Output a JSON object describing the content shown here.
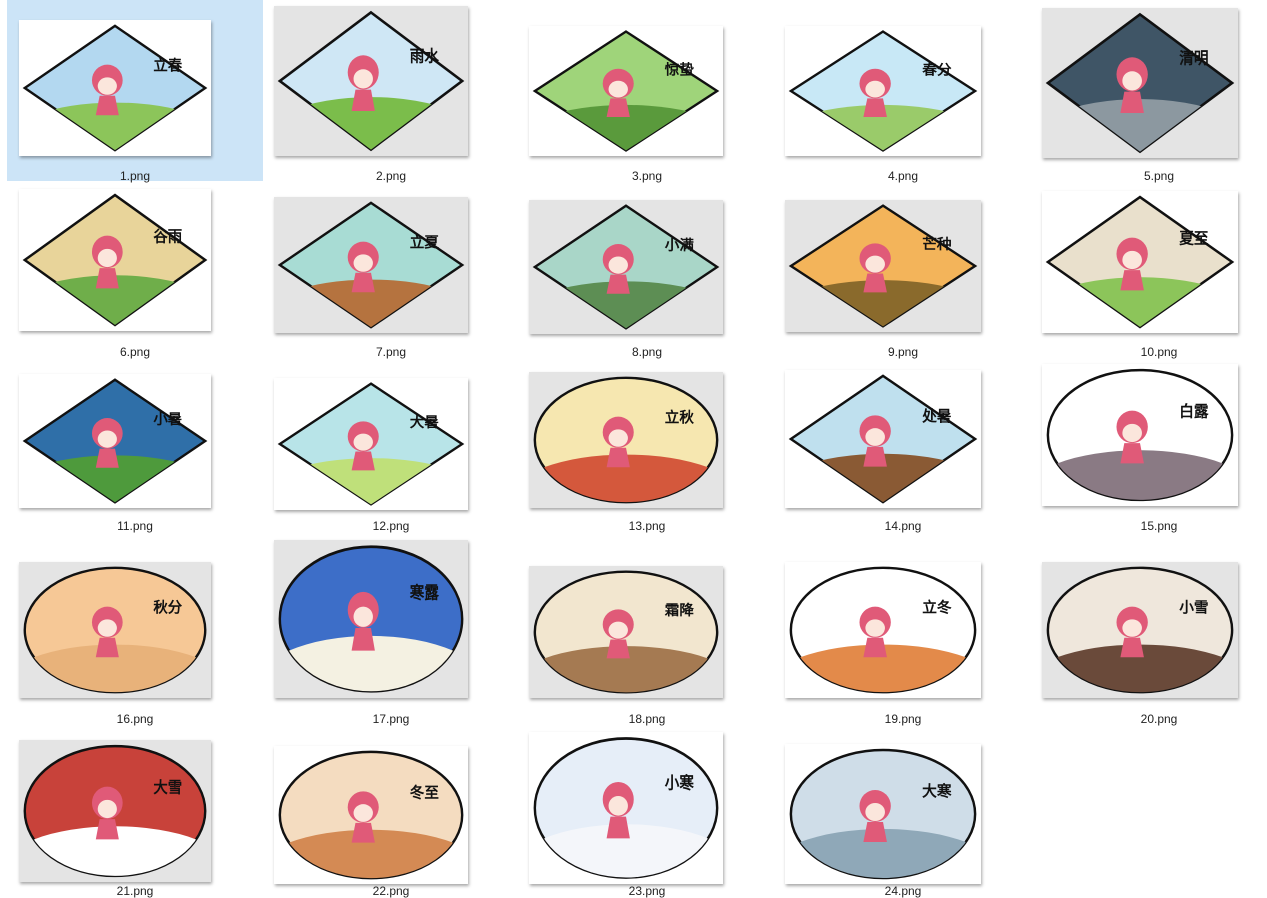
{
  "selected_index": 0,
  "files": [
    {
      "name": "1.png",
      "shape": "diamond",
      "bg": "#ffffff",
      "pal": [
        "#b3d8f0",
        "#8cc55a",
        "#e05a78"
      ],
      "text": "立春"
    },
    {
      "name": "2.png",
      "shape": "diamond",
      "bg": "#e4e4e4",
      "pal": [
        "#cfe7f5",
        "#7bbd4b",
        "#e05a78"
      ],
      "text": "雨水"
    },
    {
      "name": "3.png",
      "shape": "diamond",
      "bg": "#ffffff",
      "pal": [
        "#9fd47a",
        "#5a9a3c",
        "#e05a78"
      ],
      "text": "惊蛰"
    },
    {
      "name": "4.png",
      "shape": "diamond",
      "bg": "#ffffff",
      "pal": [
        "#c8e8f6",
        "#9acb6a",
        "#e05a78"
      ],
      "text": "春分"
    },
    {
      "name": "5.png",
      "shape": "diamond",
      "bg": "#e4e4e4",
      "pal": [
        "#3f5566",
        "#8c98a0",
        "#e05a78"
      ],
      "text": "清明"
    },
    {
      "name": "6.png",
      "shape": "diamond",
      "bg": "#ffffff",
      "pal": [
        "#e8d49a",
        "#6fae4a",
        "#e05a78"
      ],
      "text": "谷雨"
    },
    {
      "name": "7.png",
      "shape": "diamond",
      "bg": "#e4e4e4",
      "pal": [
        "#a8dcd4",
        "#b5733f",
        "#e05a78"
      ],
      "text": "立夏"
    },
    {
      "name": "8.png",
      "shape": "diamond",
      "bg": "#e4e4e4",
      "pal": [
        "#a9d6c8",
        "#5d8e54",
        "#e05a78"
      ],
      "text": "小满"
    },
    {
      "name": "9.png",
      "shape": "diamond",
      "bg": "#e4e4e4",
      "pal": [
        "#f3b45a",
        "#8a6a2c",
        "#e05a78"
      ],
      "text": "芒种"
    },
    {
      "name": "10.png",
      "shape": "diamond",
      "bg": "#ffffff",
      "pal": [
        "#e9e0cc",
        "#8cc55a",
        "#e05a78"
      ],
      "text": "夏至"
    },
    {
      "name": "11.png",
      "shape": "diamond",
      "bg": "#ffffff",
      "pal": [
        "#2f6fa8",
        "#4e9a3c",
        "#e05a78"
      ],
      "text": "小暑"
    },
    {
      "name": "12.png",
      "shape": "diamond",
      "bg": "#ffffff",
      "pal": [
        "#b8e4e8",
        "#bfe07a",
        "#e05a78"
      ],
      "text": "大暑"
    },
    {
      "name": "13.png",
      "shape": "oval",
      "bg": "#e4e4e4",
      "pal": [
        "#f6e7b0",
        "#d4583c",
        "#e05a78"
      ],
      "text": "立秋"
    },
    {
      "name": "14.png",
      "shape": "diamond",
      "bg": "#ffffff",
      "pal": [
        "#bfe0ee",
        "#8a5a34",
        "#e05a78"
      ],
      "text": "处暑"
    },
    {
      "name": "15.png",
      "shape": "oval",
      "bg": "#ffffff",
      "pal": [
        "#ffffff",
        "#8a7a84",
        "#e05a78"
      ],
      "text": "白露"
    },
    {
      "name": "16.png",
      "shape": "oval",
      "bg": "#e4e4e4",
      "pal": [
        "#f6c896",
        "#e8b27a",
        "#e05a78"
      ],
      "text": "秋分"
    },
    {
      "name": "17.png",
      "shape": "oval",
      "bg": "#e4e4e4",
      "pal": [
        "#3d6ec8",
        "#f4f1e2",
        "#e05a78"
      ],
      "text": "寒露"
    },
    {
      "name": "18.png",
      "shape": "oval",
      "bg": "#e4e4e4",
      "pal": [
        "#f2e6cf",
        "#a57a52",
        "#e05a78"
      ],
      "text": "霜降"
    },
    {
      "name": "19.png",
      "shape": "oval",
      "bg": "#ffffff",
      "pal": [
        "#ffffff",
        "#e38a4a",
        "#e05a78"
      ],
      "text": "立冬"
    },
    {
      "name": "20.png",
      "shape": "oval",
      "bg": "#e4e4e4",
      "pal": [
        "#efe7dc",
        "#6a4a3a",
        "#e05a78"
      ],
      "text": "小雪"
    },
    {
      "name": "21.png",
      "shape": "oval",
      "bg": "#e4e4e4",
      "pal": [
        "#c8423a",
        "#ffffff",
        "#e05a78"
      ],
      "text": "大雪"
    },
    {
      "name": "22.png",
      "shape": "oval",
      "bg": "#ffffff",
      "pal": [
        "#f4dcc0",
        "#d48a54",
        "#e05a78"
      ],
      "text": "冬至"
    },
    {
      "name": "23.png",
      "shape": "oval",
      "bg": "#ffffff",
      "pal": [
        "#e6eef8",
        "#f4f6fa",
        "#e05a78"
      ],
      "text": "小寒"
    },
    {
      "name": "24.png",
      "shape": "oval",
      "bg": "#ffffff",
      "pal": [
        "#cfdde8",
        "#8fa8b8",
        "#e05a78"
      ],
      "text": "大寒"
    }
  ]
}
